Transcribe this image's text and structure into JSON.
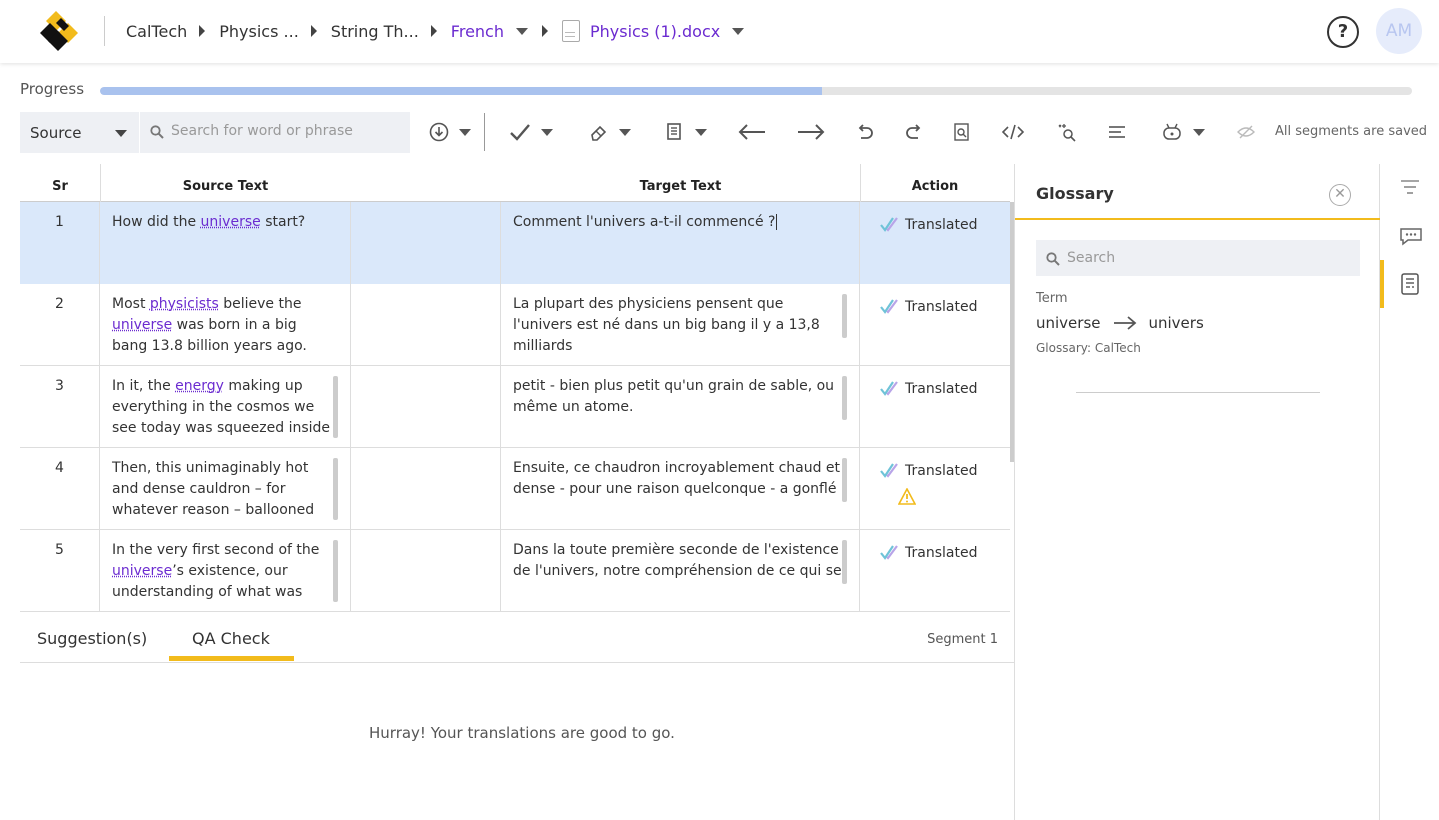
{
  "header": {
    "breadcrumbs": [
      "CalTech",
      "Physics ...",
      "String Th...",
      "French",
      "Physics (1).docx"
    ],
    "avatar_initials": "AM",
    "help_label": "?"
  },
  "progress": {
    "label": "Progress",
    "fraction": 0.55
  },
  "toolbar": {
    "source_select": "Source",
    "search_placeholder": "Search for word or phrase",
    "save_status": "All segments are saved"
  },
  "table": {
    "columns": [
      "Sr",
      "Source Text",
      "Target Text",
      "Action"
    ],
    "rows": [
      {
        "sr": "1",
        "source": [
          {
            "t": "How did the "
          },
          {
            "t": "universe",
            "term": true
          },
          {
            "t": " start?"
          }
        ],
        "target": "Comment l'univers a-t-il commencé ?",
        "status": "Translated",
        "active": true
      },
      {
        "sr": "2",
        "source": [
          {
            "t": "Most "
          },
          {
            "t": "physicists",
            "term": true
          },
          {
            "t": " believe the "
          },
          {
            "t": "universe",
            "term": true
          },
          {
            "t": " was born in a big bang 13.8 billion years ago."
          }
        ],
        "target": "La plupart des physiciens pensent que l'univers est né dans un big bang il y a 13,8 milliards",
        "status": "Translated"
      },
      {
        "sr": "3",
        "source": [
          {
            "t": "In it, the "
          },
          {
            "t": "energy",
            "term": true
          },
          {
            "t": " making up everything in the cosmos we see today was squeezed inside"
          }
        ],
        "target": "petit - bien plus petit qu'un grain de sable, ou même un atome.",
        "status": "Translated"
      },
      {
        "sr": "4",
        "source": [
          {
            "t": "Then, this unimaginably hot and dense cauldron – for whatever reason – ballooned"
          }
        ],
        "target": "Ensuite, ce chaudron incroyablement chaud et dense - pour une raison quelconque - a gonflé",
        "status": "Translated",
        "warning": true
      },
      {
        "sr": "5",
        "source": [
          {
            "t": "In the very first second of the "
          },
          {
            "t": "universe",
            "term": true
          },
          {
            "t": "’s existence, our understanding of what was"
          }
        ],
        "target": "Dans la toute première seconde de l'existence de l'univers, notre compréhension de ce qui se",
        "status": "Translated"
      }
    ]
  },
  "bottom": {
    "tabs": [
      "Suggestion(s)",
      "QA Check"
    ],
    "active_tab": "QA Check",
    "segment_label": "Segment 1",
    "message": "Hurray! Your translations are good to go."
  },
  "glossary": {
    "title": "Glossary",
    "search_placeholder": "Search",
    "term_label": "Term",
    "source_term": "universe",
    "target_term": "univers",
    "glossary_source": "Glossary: CalTech"
  },
  "colors": {
    "accent_yellow": "#f2bb1c",
    "purple": "#6b2bd0",
    "active_row": "#dae8fa",
    "progress_fill": "#a9c2ee"
  }
}
